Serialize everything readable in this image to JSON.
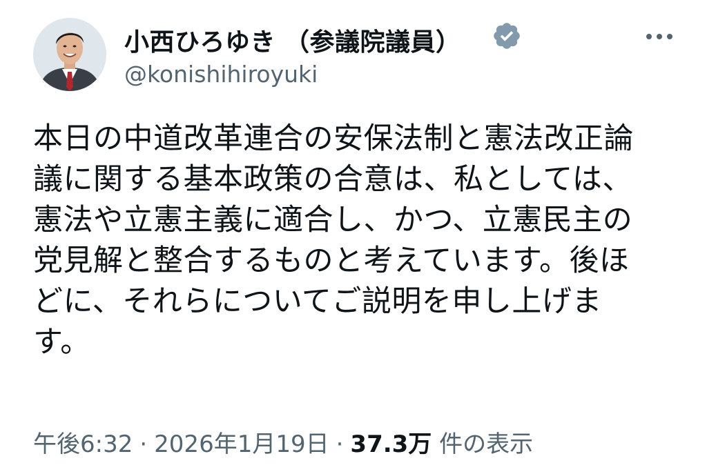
{
  "author": {
    "display_name": "小西ひろゆき （参議院議員）",
    "handle": "@konishihiroyuki",
    "verified_icon": "verified-badge-icon",
    "verified_color": "#829aab"
  },
  "more_icon": "more-dots-icon",
  "tweet": {
    "text": "本日の中道改革連合の安保法制と憲法改正論\n議に関する基本政策の合意は、私としては、\n憲法や立憲主義に適合し、かつ、立憲民主の\n党見解と整合するものと考えています。後ほ\nどに、それらについてご説明を申し上げま\nす。"
  },
  "meta": {
    "time": "午後6:32",
    "separator": "·",
    "date": "2026年1月19日",
    "views_count": "37.3万",
    "views_label": "件の表示"
  },
  "colors": {
    "text": "#0f1419",
    "secondary": "#536471"
  }
}
